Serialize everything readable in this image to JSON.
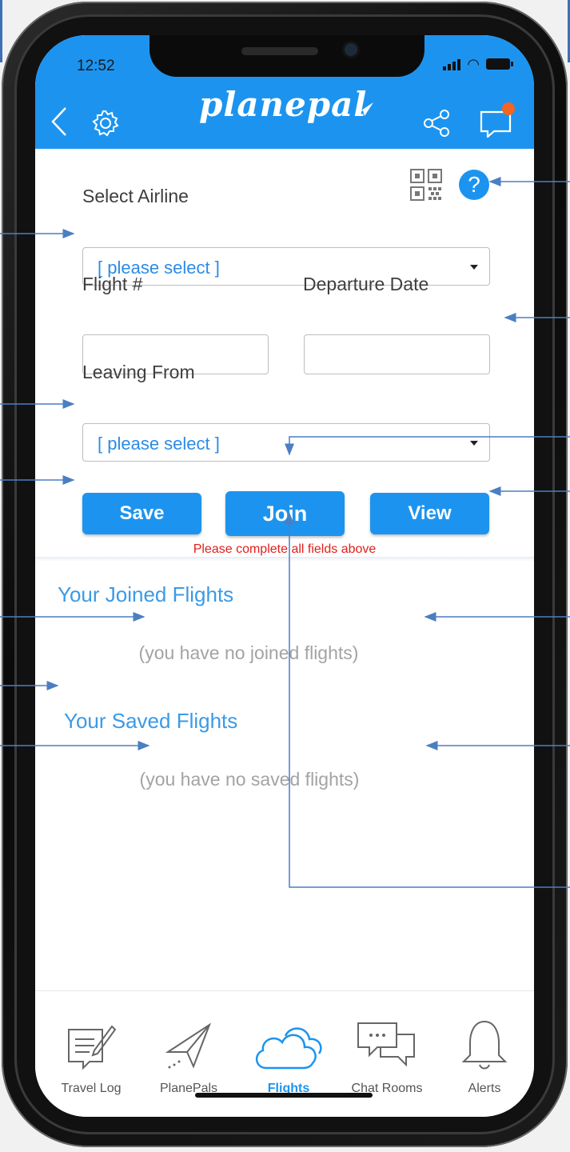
{
  "status_bar": {
    "time": "12:52"
  },
  "header": {
    "logo": "planepal",
    "accent_color": "#1c94ef",
    "notification_dot_color": "#f26522"
  },
  "icons": {
    "back": "back-chevron-icon",
    "settings": "gear-icon",
    "share": "share-icon",
    "messages": "chat-icon",
    "qr": "qr-code-icon",
    "help": "help-icon"
  },
  "help_label": "?",
  "form": {
    "airline_label": "Select Airline",
    "airline_value": "[ please select ]",
    "flight_label": "Flight #",
    "flight_value": "",
    "date_label": "Departure Date",
    "date_value": "",
    "leaving_label": "Leaving From",
    "leaving_value": "[ please select ]"
  },
  "buttons": {
    "save": "Save",
    "join": "Join",
    "view": "View"
  },
  "warning": "Please complete all fields above",
  "joined": {
    "title": "Your Joined Flights",
    "empty": "(you have no joined flights)"
  },
  "saved": {
    "title": "Your Saved Flights",
    "empty": "(you have no saved flights)"
  },
  "tabs": [
    {
      "label": "Travel Log",
      "icon": "notebook-pencil-icon",
      "active": false
    },
    {
      "label": "PlanePals",
      "icon": "paper-plane-icon",
      "active": false
    },
    {
      "label": "Flights",
      "icon": "cloud-icon",
      "active": true
    },
    {
      "label": "Chat Rooms",
      "icon": "chat-bubbles-icon",
      "active": false
    },
    {
      "label": "Alerts",
      "icon": "bell-icon",
      "active": false
    }
  ],
  "annotation_color": "#4a7fc1"
}
